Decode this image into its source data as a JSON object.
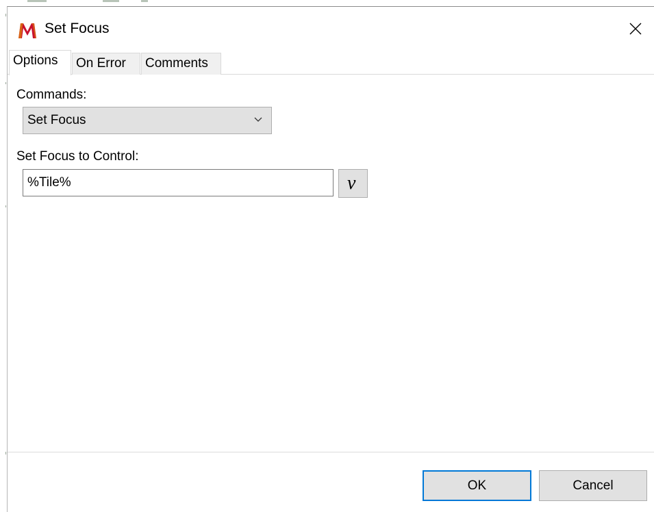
{
  "window": {
    "title": "Set Focus",
    "icon": "app-logo-m-icon",
    "close_icon": "close-icon"
  },
  "tabs": [
    {
      "label": "Options",
      "active": true
    },
    {
      "label": "On Error",
      "active": false
    },
    {
      "label": "Comments",
      "active": false
    }
  ],
  "options": {
    "commands_label": "Commands:",
    "commands_value": "Set Focus",
    "focus_label": "Set Focus to Control:",
    "focus_value": "%Tile%",
    "variable_button_glyph": "v"
  },
  "footer": {
    "ok_label": "OK",
    "cancel_label": "Cancel"
  },
  "colors": {
    "accent": "#0078d7",
    "logo_red": "#c8102e",
    "button_face": "#e1e1e1"
  }
}
